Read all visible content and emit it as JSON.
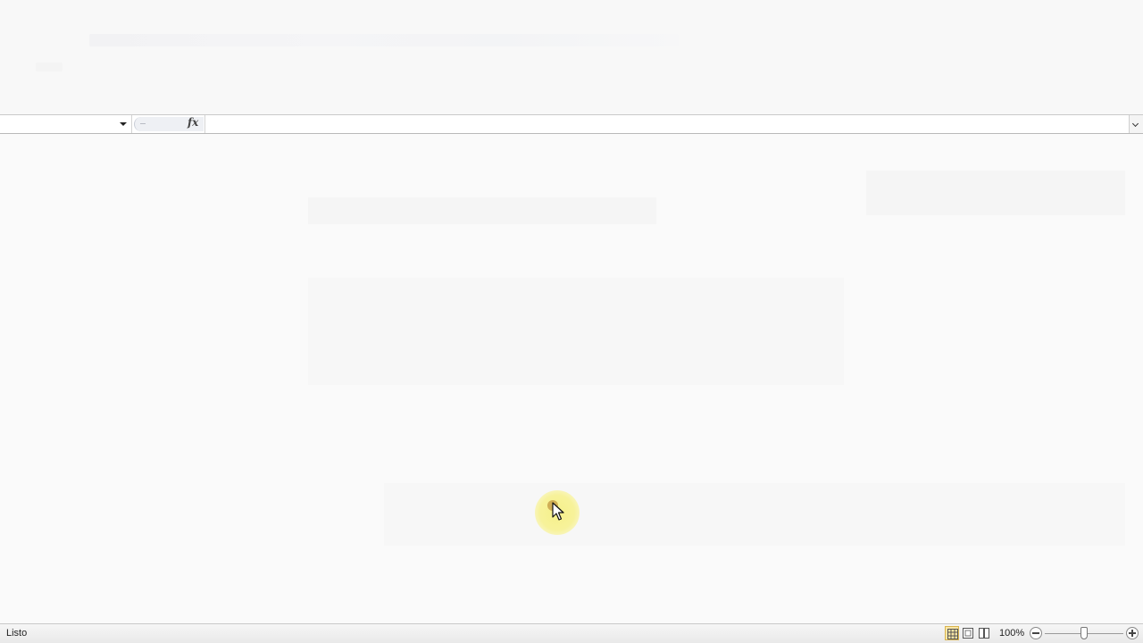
{
  "window": {
    "app": "spreadsheet",
    "state": "faded"
  },
  "formula_bar": {
    "name_box_value": "",
    "fx_label": "fx",
    "formula_value": ""
  },
  "status_bar": {
    "status_text": "Listo",
    "zoom_level": "100%"
  },
  "colors": {
    "status_bar_bg": "#e9e9e9",
    "active_view_highlight": "#fbe7a6",
    "cursor_highlight": "#f6f08a"
  },
  "icons": {
    "name_box_dropdown": "chevron-down-icon",
    "fx": "function-icon",
    "formula_expand": "chevron-down-icon",
    "view_normal": "grid-icon",
    "view_page_layout": "page-layout-icon",
    "view_page_break": "page-break-icon",
    "zoom_out": "minus-circle-icon",
    "zoom_in": "plus-circle-icon",
    "cursor": "mouse-pointer-icon"
  }
}
